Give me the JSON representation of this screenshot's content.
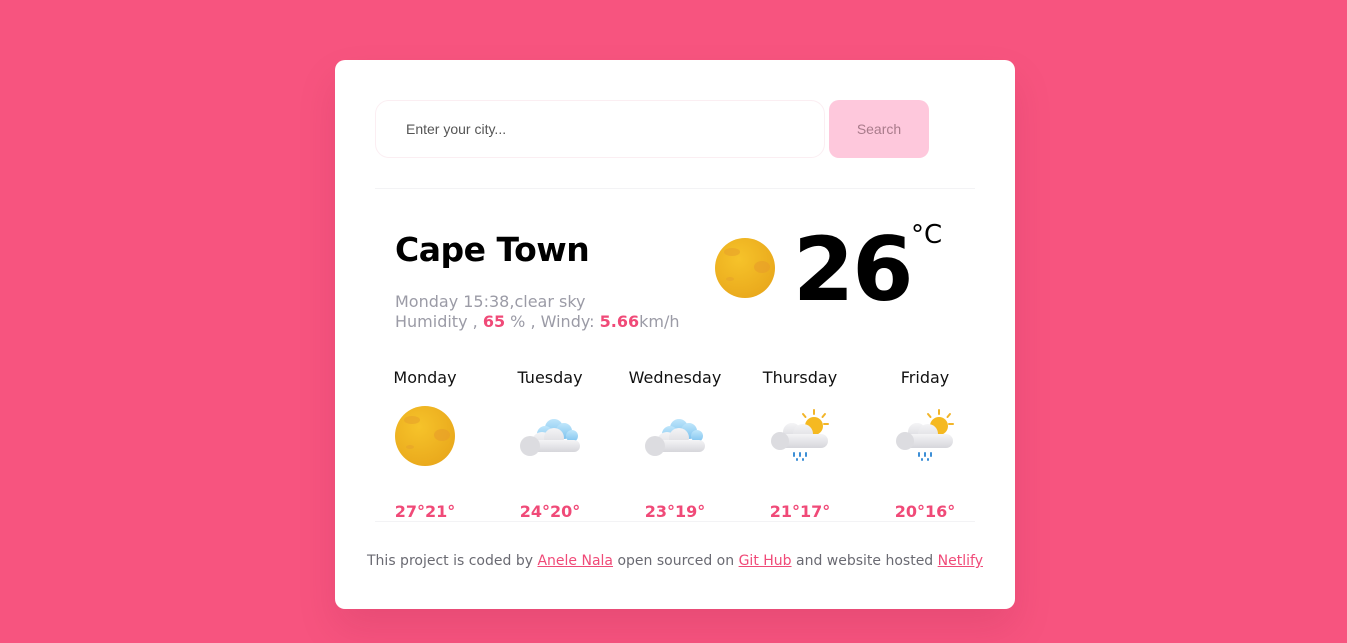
{
  "search": {
    "placeholder": "Enter your city...",
    "button_label": "Search"
  },
  "current": {
    "city": "Cape Town",
    "datetime": "Monday 15:38",
    "description": "clear sky",
    "humidity_label": "Humidity ,",
    "humidity_value": "65",
    "humidity_unit": "% , Windy:",
    "wind_value": "5.66",
    "wind_unit": "km/h",
    "temperature": "26",
    "unit": "°C",
    "icon": "sun-icon"
  },
  "forecast": [
    {
      "day": "Monday",
      "temps": "27°21°",
      "icon": "sun-icon"
    },
    {
      "day": "Tuesday",
      "temps": "24°20°",
      "icon": "cloud-icon"
    },
    {
      "day": "Wednesday",
      "temps": "23°19°",
      "icon": "cloud-icon"
    },
    {
      "day": "Thursday",
      "temps": "21°17°",
      "icon": "sun-cloud-rain-icon"
    },
    {
      "day": "Friday",
      "temps": "20°16°",
      "icon": "sun-cloud-rain-icon"
    }
  ],
  "footer": {
    "text_1": "This project is coded by",
    "author": "Anele Nala",
    "text_2": "open sourced on",
    "repo": "Git Hub",
    "text_3": "and website hosted",
    "host": "Netlify"
  },
  "colors": {
    "background": "#f7547f",
    "accent": "#f04a78",
    "button": "#fec8dc"
  }
}
